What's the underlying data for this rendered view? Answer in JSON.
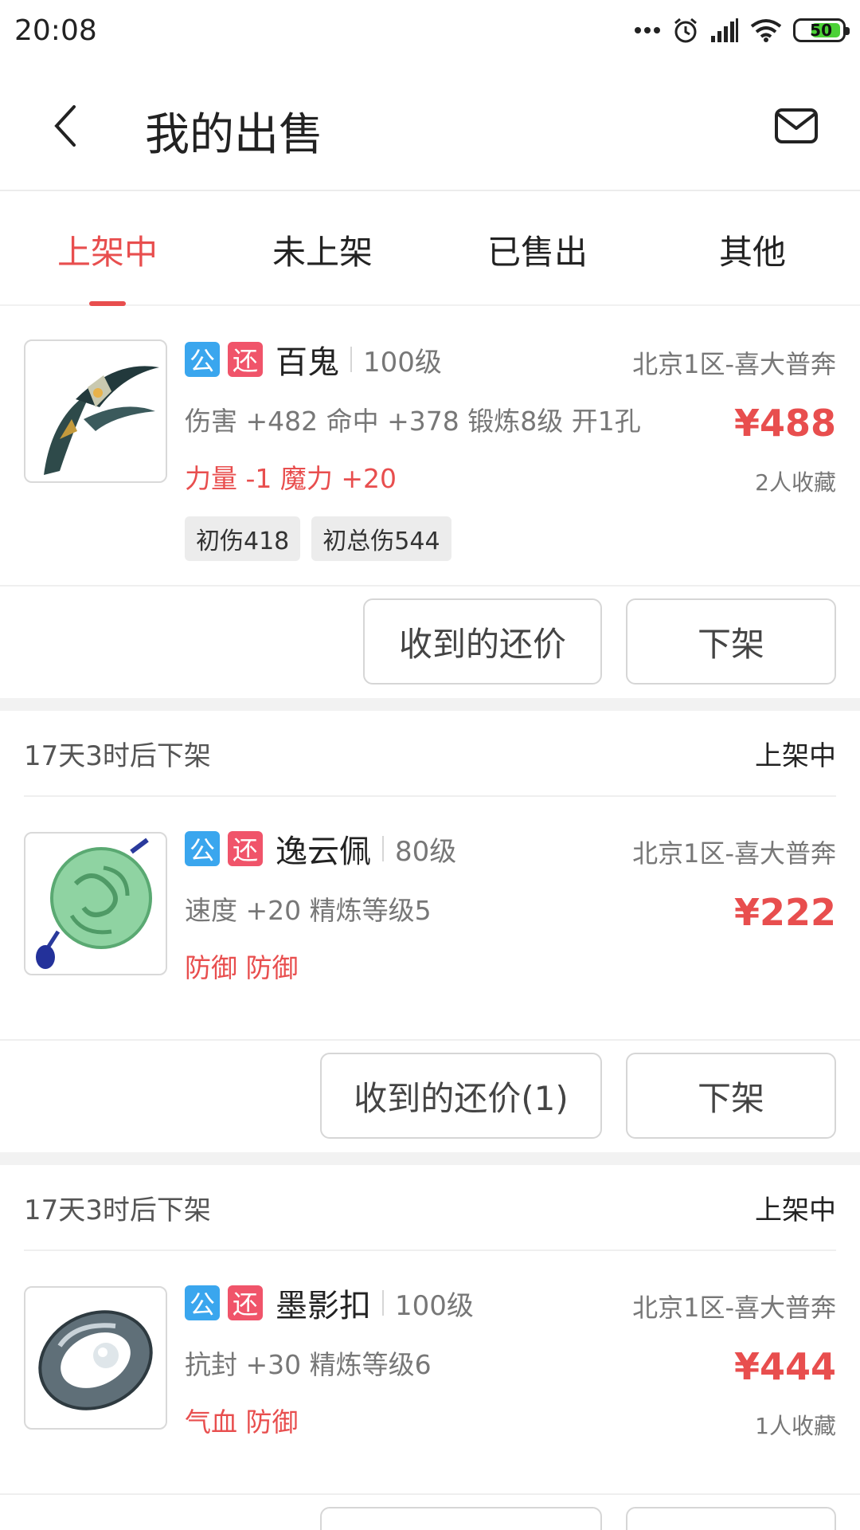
{
  "status_bar": {
    "time": "20:08",
    "battery": "50",
    "icons": [
      "more-dots-icon",
      "alarm-icon",
      "signal-icon",
      "wifi-icon",
      "battery-icon"
    ]
  },
  "header": {
    "title": "我的出售",
    "back_icon": "chevron-left-icon",
    "mail_icon": "mail-icon"
  },
  "tabs": [
    {
      "label": "上架中",
      "active": true
    },
    {
      "label": "未上架",
      "active": false
    },
    {
      "label": "已售出",
      "active": false
    },
    {
      "label": "其他",
      "active": false
    }
  ],
  "colors": {
    "accent": "#e84e4e",
    "badge_public": "#3aa6ee",
    "badge_bargain": "#f0546a"
  },
  "items": [
    {
      "badge_public": "公",
      "badge_bargain": "还",
      "name": "百鬼",
      "level": "100级",
      "server": "北京1区-喜大普奔",
      "stats": "伤害 +482 命中 +378 锻炼8级 开1孔",
      "price": "¥488",
      "attrs": "力量 -1 魔力 +20",
      "favorites": "2人收藏",
      "tags": [
        "初伤418",
        "初总伤544"
      ],
      "offers_button": "收到的还价",
      "delist_button": "下架"
    },
    {
      "expire": "17天3时后下架",
      "status": "上架中",
      "badge_public": "公",
      "badge_bargain": "还",
      "name": "逸云佩",
      "level": "80级",
      "server": "北京1区-喜大普奔",
      "stats": "速度 +20 精炼等级5",
      "price": "¥222",
      "attrs": "防御 防御",
      "offers_button": "收到的还价(1)",
      "delist_button": "下架"
    },
    {
      "expire": "17天3时后下架",
      "status": "上架中",
      "badge_public": "公",
      "badge_bargain": "还",
      "name": "墨影扣",
      "level": "100级",
      "server": "北京1区-喜大普奔",
      "stats": "抗封 +30 精炼等级6",
      "price": "¥444",
      "attrs": "气血 防御",
      "favorites": "1人收藏"
    }
  ]
}
